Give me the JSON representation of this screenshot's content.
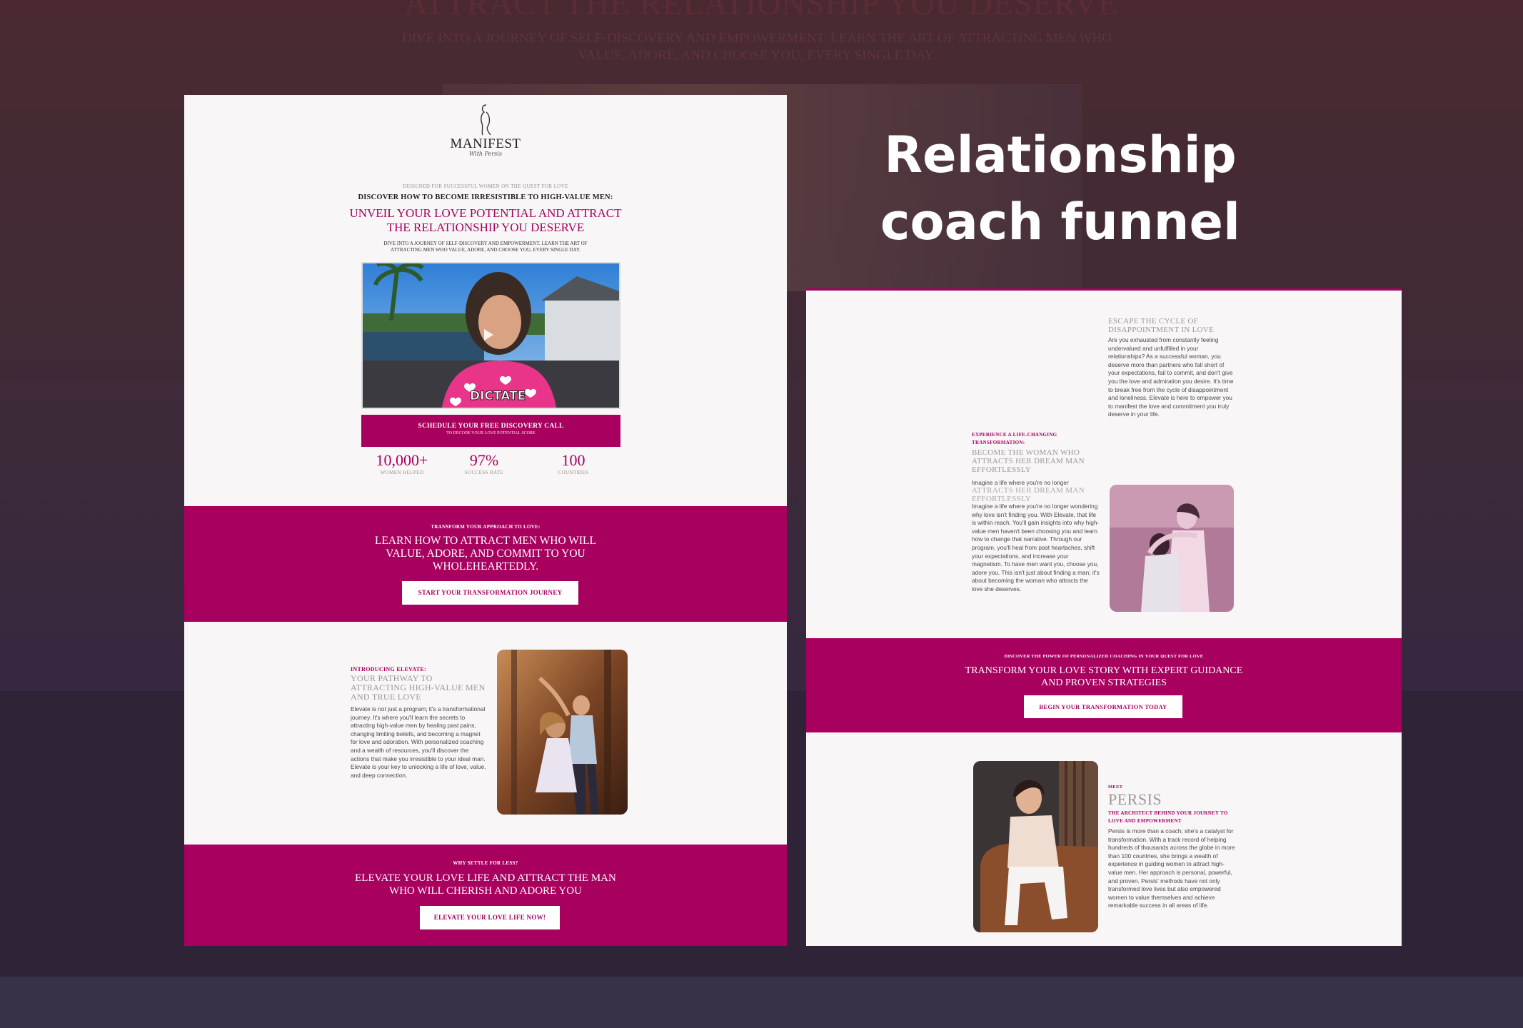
{
  "background": {
    "title": "ATTRACT THE RELATIONSHIP YOU DESERVE",
    "subtitle": "DIVE INTO A JOURNEY OF SELF-DISCOVERY AND EMPOWERMENT. LEARN THE ART OF ATTRACTING MEN WHO VALUE, ADORE, AND CHOOSE YOU, EVERY SINGLE DAY."
  },
  "headline": "Relationship coach funnel",
  "left_page": {
    "logo": {
      "name": "MANIFEST",
      "script": "With Persis"
    },
    "eyebrow": "DESIGNED FOR SUCCESSFUL WOMEN ON THE QUEST FOR LOVE",
    "kicker": "DISCOVER HOW TO BECOME IRRESISTIBLE TO HIGH-VALUE MEN:",
    "title": "UNVEIL YOUR LOVE POTENTIAL AND ATTRACT THE RELATIONSHIP YOU DESERVE",
    "subtitle": "DIVE INTO A JOURNEY OF SELF-DISCOVERY AND EMPOWERMENT. LEARN THE ART OF ATTRACTING MEN WHO VALUE, ADORE, AND CHOOSE YOU, EVERY SINGLE DAY.",
    "video_caption": "DICTATE",
    "cta": {
      "label": "SCHEDULE YOUR FREE DISCOVERY CALL",
      "sub": "TO DECODE YOUR LOVE POTENTIAL SCORE"
    },
    "stats": [
      {
        "value": "10,000+",
        "label": "WOMEN HELPED"
      },
      {
        "value": "97%",
        "label": "SUCCESS RATE"
      },
      {
        "value": "100",
        "label": "COUNTRIES"
      }
    ],
    "band1": {
      "eyebrow": "TRANSFORM YOUR APPROACH TO LOVE:",
      "title": "LEARN HOW TO ATTRACT MEN WHO WILL VALUE, ADORE, AND COMMIT TO YOU WHOLEHEARTEDLY.",
      "button": "START YOUR TRANSFORMATION JOURNEY"
    },
    "elevate": {
      "label": "INTRODUCING ELEVATE:",
      "heading": "YOUR PATHWAY TO ATTRACTING HIGH-VALUE MEN AND TRUE LOVE",
      "body": "Elevate is not just a program; it's a transformational journey. It's where you'll learn the secrets to attracting high-value men by healing past pains, changing limiting beliefs, and becoming a magnet for love and adoration. With personalized coaching and a wealth of resources, you'll discover the actions that make you irresistible to your ideal man. Elevate is your key to unlocking a life of love, value, and deep connection."
    },
    "band2": {
      "eyebrow": "WHY SETTLE FOR LESS?",
      "title": "ELEVATE YOUR LOVE LIFE AND ATTRACT THE MAN WHO WILL CHERISH AND ADORE YOU",
      "button": "ELEVATE YOUR LOVE LIFE NOW!"
    }
  },
  "right_page": {
    "escape": {
      "heading": "ESCAPE THE CYCLE OF DISAPPOINTMENT IN LOVE",
      "body": "Are you exhausted from constantly feeling undervalued and unfulfilled in your relationships? As a successful woman, you deserve more than partners who fall short of your expectations, fail to commit, and don't give you the love and admiration you desire. It's time to break free from the cycle of disappointment and loneliness. Elevate is here to empower you to manifest the love and commitment you truly deserve in your life."
    },
    "experience": {
      "label": "EXPERIENCE A LIFE-CHANGING TRANSFORMATION:",
      "heading": "BECOME THE WOMAN WHO ATTRACTS HER DREAM MAN EFFORTLESSLY",
      "ghost_line": "Imagine a life where you're no longer",
      "ghost_heading": "ATTRACTS HER DREAM MAN EFFORTLESSLY",
      "body": "Imagine a life where you're no longer wondering why love isn't finding you. With Elevate, that life is within reach. You'll gain insights into why high-value men haven't been choosing you and learn how to change that narrative. Through our program, you'll heal from past heartaches, shift your expectations, and increase your magnetism. To have men want you, choose you, adore you. This isn't just about finding a man; it's about becoming the woman who attracts the love she deserves."
    },
    "band": {
      "eyebrow": "DISCOVER THE POWER OF PERSONALIZED COACHING IN YOUR QUEST FOR LOVE",
      "title": "TRANSFORM YOUR LOVE STORY WITH EXPERT GUIDANCE AND PROVEN STRATEGIES",
      "button": "BEGIN YOUR TRANSFORMATION TODAY"
    },
    "meet": {
      "label": "MEET",
      "name": "PERSIS",
      "tagline": "THE ARCHITECT BEHIND YOUR JOURNEY TO LOVE AND EMPOWERMENT",
      "body": "Persis is more than a coach; she's a catalyst for transformation. With a track record of helping hundreds of thousands across the globe in more than 100 countries, she brings a wealth of experience in guiding women to attract high-value men. Her approach is personal, powerful, and proven. Persis' methods have not only transformed love lives but also empowered women to value themselves and achieve remarkable success in all areas of life."
    }
  }
}
